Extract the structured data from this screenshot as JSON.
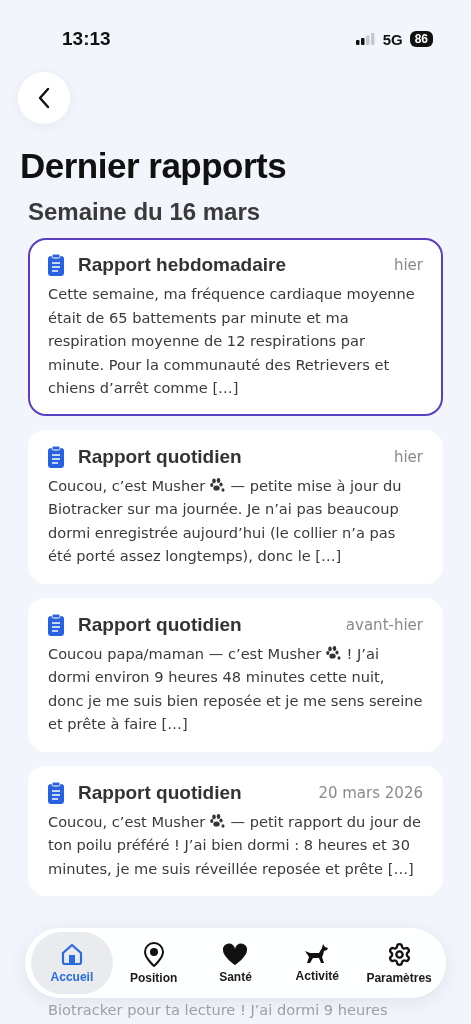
{
  "status_bar": {
    "time": "13:13",
    "network": "5G",
    "battery": "86"
  },
  "title": "Dernier rapports",
  "section": "Semaine du 16 mars",
  "reports": [
    {
      "kind": "full",
      "title": "Rapport hebdomadaire",
      "date": "hier",
      "selected": true,
      "body": [
        {
          "kind": "text",
          "text": "Cette semaine, ma fréquence cardiaque moyenne était de 65 battements par minute et ma respiration moyenne de 12 respirations par minute. Pour la communauté des Retrievers et chiens d’arrêt comme […]"
        }
      ]
    },
    {
      "kind": "full",
      "title": "Rapport quotidien",
      "date": "hier",
      "selected": false,
      "body": [
        {
          "kind": "text",
          "text": "Coucou, c’est Musher "
        },
        {
          "kind": "paw"
        },
        {
          "kind": "text",
          "text": " — petite mise à jour du Biotracker sur ma journée. Je n’ai pas beaucoup dormi enregistrée aujourd’hui (le collier n’a pas été porté assez longtemps), donc le […]"
        }
      ]
    },
    {
      "kind": "full",
      "title": "Rapport quotidien",
      "date": "avant-hier",
      "selected": false,
      "body": [
        {
          "kind": "text",
          "text": "Coucou papa/maman — c’est Musher "
        },
        {
          "kind": "paw"
        },
        {
          "kind": "text",
          "text": " ! J’ai dormi environ 9 heures 48 minutes cette nuit, donc je me suis bien reposée et je me sens sereine et prête à faire […]"
        }
      ]
    },
    {
      "kind": "full",
      "title": "Rapport quotidien",
      "date": "20 mars 2026",
      "selected": false,
      "body": [
        {
          "kind": "text",
          "text": "Coucou, c’est Musher "
        },
        {
          "kind": "paw"
        },
        {
          "kind": "text",
          "text": " — petit rapport du jour de ton poilu préféré ! J’ai bien dormi : 8 heures et 30 minutes, je me suis réveillée reposée et prête […]"
        }
      ]
    },
    {
      "kind": "partial",
      "body": [
        {
          "kind": "text",
          "text": "Biotracker pour ta lecture ! J’ai dormi 9 heures"
        }
      ]
    }
  ],
  "tabs": [
    {
      "label": "Accueil",
      "selected": true
    },
    {
      "label": "Position",
      "selected": false
    },
    {
      "label": "Santé",
      "selected": false
    },
    {
      "label": "Activité",
      "selected": false
    },
    {
      "label": "Paramètres",
      "selected": false
    }
  ]
}
